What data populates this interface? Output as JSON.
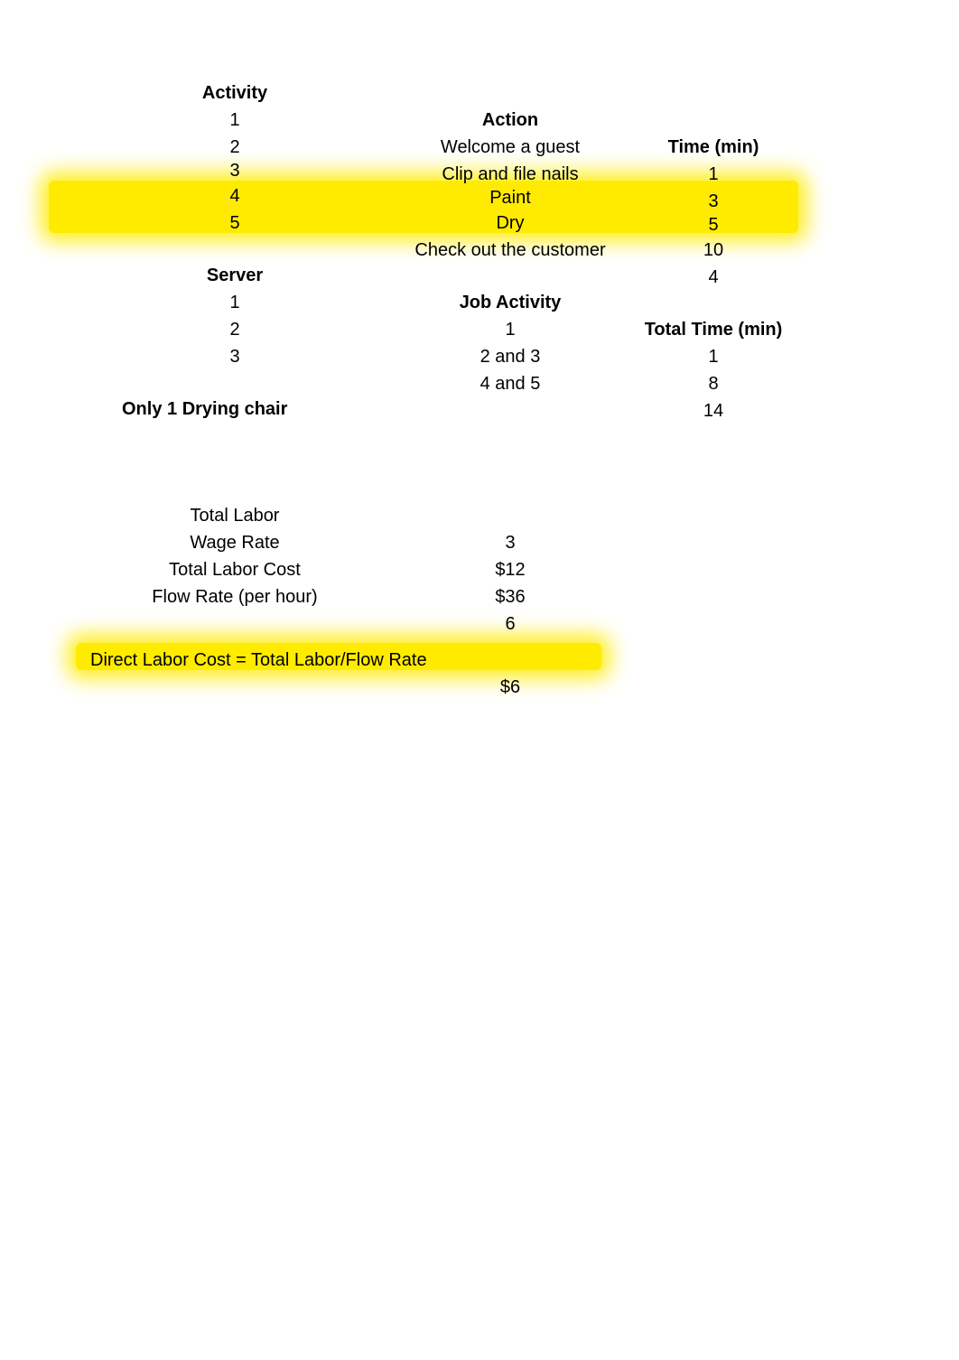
{
  "table1": {
    "headers": {
      "activity": "Activity",
      "action": "Action",
      "time": "Time (min)"
    },
    "rows": [
      {
        "activity": "1",
        "action": "Welcome a guest",
        "time": "1"
      },
      {
        "activity": "2",
        "action": "Clip and file nails",
        "time": "3"
      },
      {
        "activity": "3",
        "action": "Paint",
        "time": "5"
      },
      {
        "activity": "4",
        "action": "Dry",
        "time": "10"
      },
      {
        "activity": "5",
        "action": "Check out the customer",
        "time": "4"
      }
    ]
  },
  "table2": {
    "headers": {
      "server": "Server",
      "job": "Job Activity",
      "total": "Total Time (min)"
    },
    "rows": [
      {
        "server": "1",
        "job": "1",
        "total": "1"
      },
      {
        "server": "2",
        "job": "2 and 3",
        "total": "8"
      },
      {
        "server": "3",
        "job": "4 and 5",
        "total": "14"
      }
    ]
  },
  "note": "Only 1 Drying chair",
  "costs": {
    "total_labor": {
      "label": "Total Labor",
      "value": "3"
    },
    "wage_rate": {
      "label": "Wage Rate",
      "value": "$12"
    },
    "total_labor_cost": {
      "label": "Total Labor Cost",
      "value": "$36"
    },
    "flow_rate": {
      "label": "Flow Rate (per hour)",
      "value": "6"
    },
    "direct_labor_cost": {
      "label": "Direct Labor Cost = Total Labor/Flow Rate",
      "value": "$6"
    }
  },
  "chart_data": [
    {
      "type": "table",
      "title": "Activity times",
      "columns": [
        "Activity",
        "Action",
        "Time (min)"
      ],
      "rows": [
        [
          1,
          "Welcome a guest",
          1
        ],
        [
          2,
          "Clip and file nails",
          3
        ],
        [
          3,
          "Paint",
          5
        ],
        [
          4,
          "Dry",
          10
        ],
        [
          5,
          "Check out the customer",
          4
        ]
      ]
    },
    {
      "type": "table",
      "title": "Server assignments",
      "columns": [
        "Server",
        "Job Activity",
        "Total Time (min)"
      ],
      "rows": [
        [
          1,
          "1",
          1
        ],
        [
          2,
          "2 and 3",
          8
        ],
        [
          3,
          "4 and 5",
          14
        ]
      ]
    }
  ]
}
